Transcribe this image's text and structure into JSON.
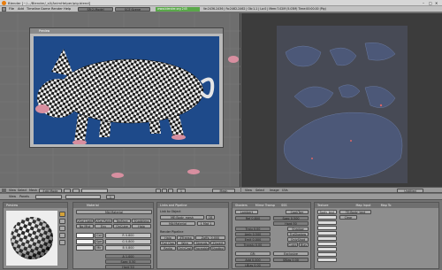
{
  "window": {
    "title": "Blender [~/.../Blender/_s0/AnimHelper/pig.blend]",
    "minimize_glyph": "–",
    "maximize_glyph": "□",
    "close_glyph": "✕"
  },
  "menubar": {
    "items": [
      "File",
      "Add",
      "Timeline",
      "Game",
      "Render",
      "Help"
    ],
    "screen_label": "SR:2-Model",
    "scene_label": "SCE:Scene",
    "url": "www.blender.org 245",
    "stats": "Ve:2436-2436 | Fa:2462-2462 | Ob:1-1 | La:0 | Mem:7.02M (5.03M) Time:00:00.00 (Pig)"
  },
  "viewport3d": {
    "panel_title": "Preview",
    "header_menus": [
      "View",
      "Select",
      "Mesh"
    ],
    "mode": "Edit Mode",
    "frame": "1",
    "shading": "Mesh"
  },
  "uv_editor": {
    "header_menus": [
      "View",
      "Select",
      "Image",
      "UVs"
    ],
    "image_name": "Untitled"
  },
  "buttons_header": {
    "menus": [
      "View",
      "Panels"
    ],
    "frame": "1"
  },
  "preview": {
    "title": "Preview"
  },
  "material": {
    "tab": "Material",
    "ma_name": "MA:Material",
    "buttons": [
      "VCol Light",
      "VCol Paint",
      "TexFace",
      "Shadeless",
      "No Mist",
      "Env",
      "OnCube",
      "Halo"
    ],
    "fields": [
      {
        "label": "Col",
        "value": "R 0.800"
      },
      {
        "label": "Spe",
        "value": "G 0.800"
      },
      {
        "label": "Mir",
        "value": "B 0.800"
      }
    ],
    "sliders": [
      {
        "label": "A 1.000"
      },
      {
        "label": "Spec 0.50"
      },
      {
        "label": "Hard 50"
      }
    ]
  },
  "links": {
    "title": "Links and Pipeline",
    "link_to_object": "Link to Object",
    "me_name": "ME:Body_mesh",
    "ob_button": "OB",
    "ma_name": "MA:Material",
    "count": "1 Mat 1",
    "render_pipeline": "Render Pipeline",
    "pipeline_buttons": [
      "Halo",
      "ZTransp",
      "Zoffs: 0.000",
      "Full Osa",
      "Wire",
      "Strands",
      "Zinvert",
      "Radio",
      "OnlyCast",
      "Traceable",
      "Shadbuf"
    ]
  },
  "shaders": {
    "title": "Shaders",
    "tabs": [
      "Mirror Transp",
      "SSS"
    ],
    "diffuse": "Lambert",
    "specular": "CookTorr",
    "fields": [
      "Ref 0.800",
      "Spec 0.500",
      "Hard:50",
      "Tralu 0.00",
      "Amb 0.500",
      "Emit 0.000",
      "Translu 0.00"
    ],
    "toggles": [
      "Shadow",
      "TraShadow",
      "OnlyShad",
      "Cubic",
      "Bias"
    ],
    "group": "GR:",
    "exclusive": "Exclusive",
    "more_fields": [
      "Add 0.000",
      "SBias 0.00",
      "LBias 0.00"
    ]
  },
  "texture": {
    "title": "Texture",
    "tabs": [
      "Map Input",
      "Map To"
    ],
    "slot": "TE:Body_text",
    "clear": "Clear",
    "slots": [
      "Body_text",
      "",
      "",
      "",
      "",
      "",
      "",
      "",
      "",
      ""
    ]
  }
}
